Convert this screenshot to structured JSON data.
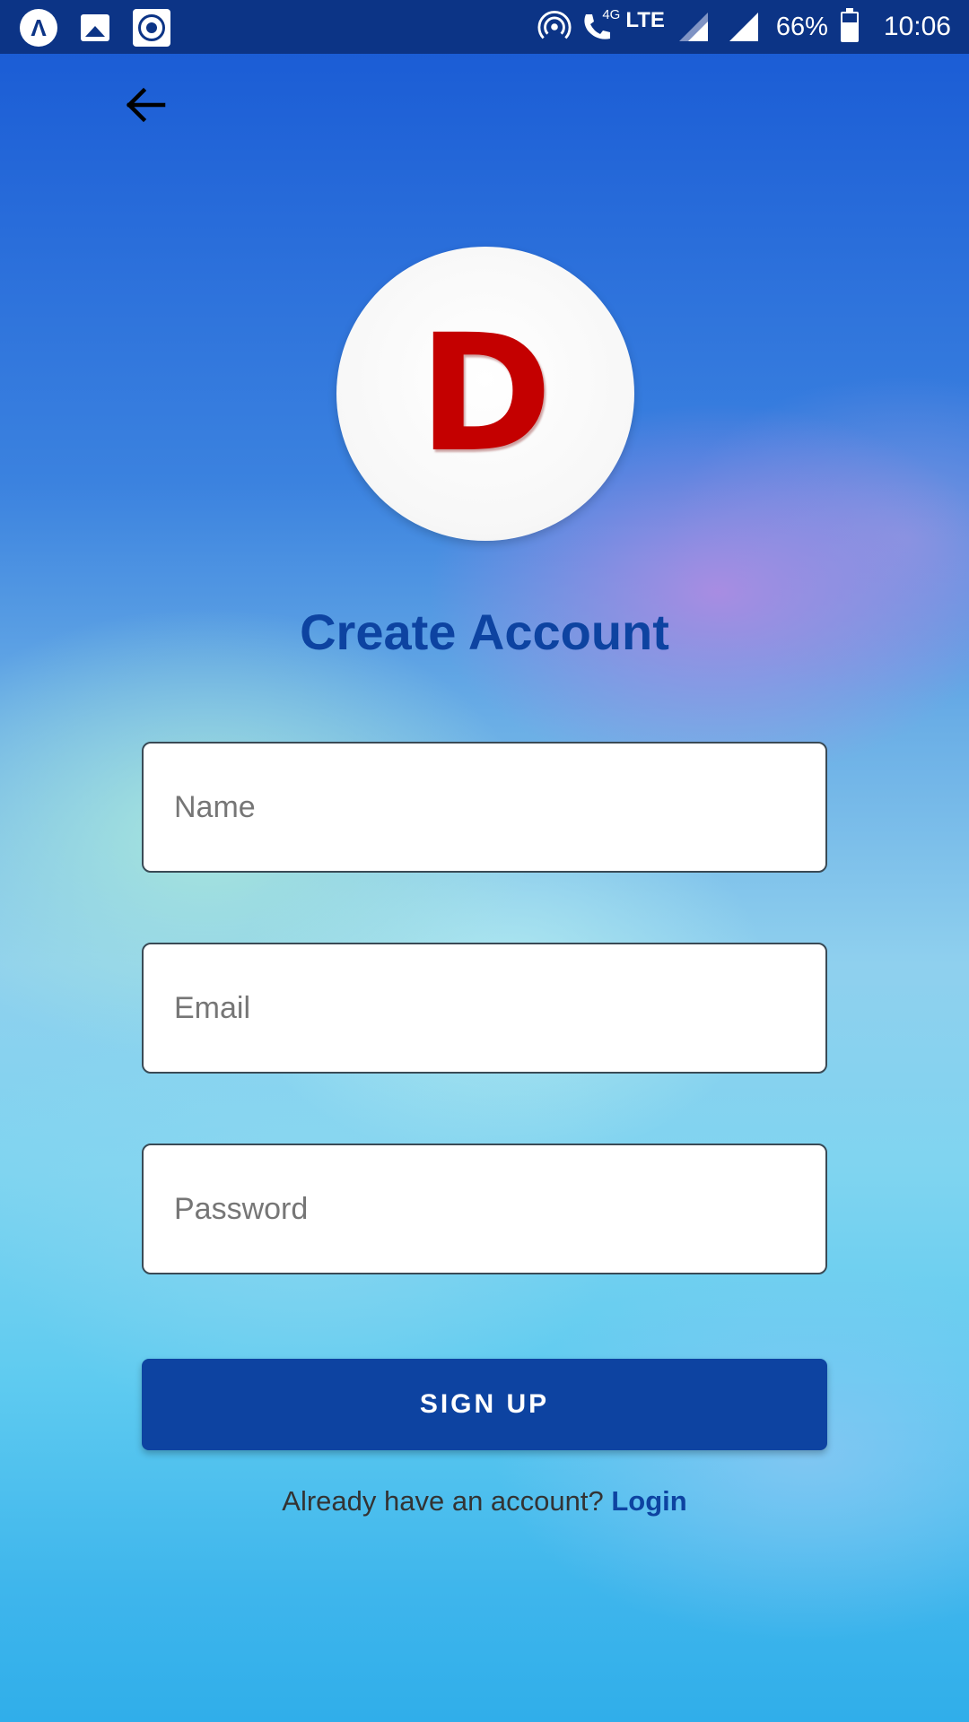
{
  "status_bar": {
    "left_icons": [
      "app-a-icon",
      "gallery-icon",
      "ring-icon"
    ],
    "network_label": "4G",
    "lte_label": "LTE",
    "battery_percent": "66%",
    "battery_level": 0.66,
    "time": "10:06"
  },
  "header": {
    "back_icon": "arrow-left-icon"
  },
  "logo": {
    "letter": "D",
    "letter_color": "#c40000"
  },
  "form": {
    "title": "Create Account",
    "name_placeholder": "Name",
    "email_placeholder": "Email",
    "password_placeholder": "Password",
    "submit_label": "SIGN UP"
  },
  "footer": {
    "prompt": "Already have an account?",
    "login_label": "Login"
  },
  "colors": {
    "primary": "#0d43a1",
    "status_bar": "#0c3486",
    "logo_red": "#c40000"
  }
}
